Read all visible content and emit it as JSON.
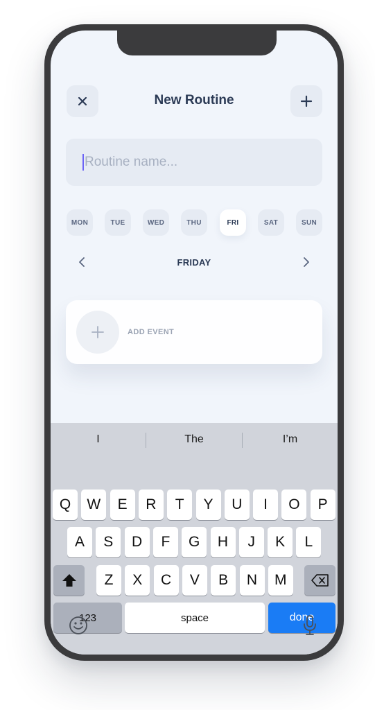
{
  "header": {
    "title": "New Routine",
    "close_icon": "close-icon",
    "add_icon": "plus-icon"
  },
  "routine_name": {
    "value": "",
    "placeholder": "Routine name..."
  },
  "days": [
    {
      "label": "MON",
      "active": false
    },
    {
      "label": "TUE",
      "active": false
    },
    {
      "label": "WED",
      "active": false
    },
    {
      "label": "THU",
      "active": false
    },
    {
      "label": "FRI",
      "active": true
    },
    {
      "label": "SAT",
      "active": false
    },
    {
      "label": "SUN",
      "active": false
    }
  ],
  "day_nav": {
    "current": "FRIDAY",
    "prev_icon": "chevron-left-icon",
    "next_icon": "chevron-right-icon"
  },
  "event_card": {
    "label": "ADD EVENT",
    "icon": "plus-icon"
  },
  "keyboard": {
    "suggestions": [
      "I",
      "The",
      "I’m"
    ],
    "row1": [
      "Q",
      "W",
      "E",
      "R",
      "T",
      "Y",
      "U",
      "I",
      "O",
      "P"
    ],
    "row2": [
      "A",
      "S",
      "D",
      "F",
      "G",
      "H",
      "J",
      "K",
      "L"
    ],
    "row3": [
      "Z",
      "X",
      "C",
      "V",
      "B",
      "N",
      "M"
    ],
    "numbers_label": "123",
    "space_label": "space",
    "done_label": "done",
    "shift_icon": "shift-icon",
    "backspace_icon": "backspace-icon",
    "emoji_icon": "emoji-icon",
    "mic_icon": "microphone-icon"
  },
  "colors": {
    "accent": "#1a7cf5",
    "text_primary": "#2b3a55",
    "caret": "#6b63f6"
  }
}
